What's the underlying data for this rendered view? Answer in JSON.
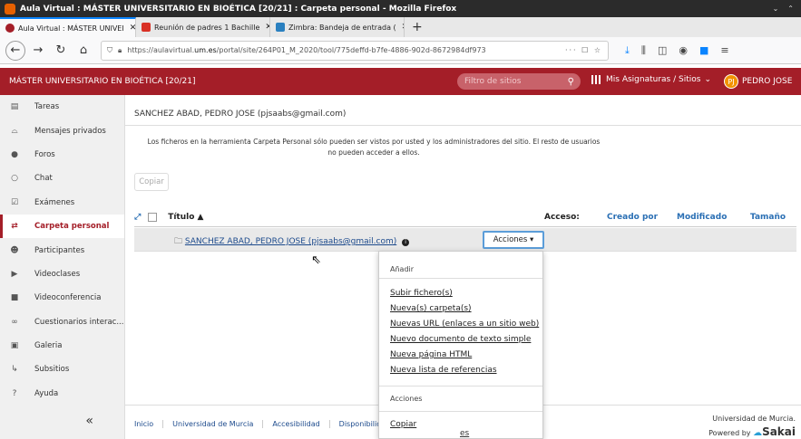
{
  "window": {
    "title": "Aula Virtual : MÁSTER UNIVERSITARIO EN BIOÉTICA [20/21] : Carpeta personal - Mozilla Firefox"
  },
  "tabs": [
    {
      "label": "Aula Virtual : MÁSTER UNIVEI",
      "active": true
    },
    {
      "label": "Reunión de padres 1 Bachille",
      "active": false
    },
    {
      "label": "Zimbra: Bandeja de entrada (",
      "active": false
    }
  ],
  "browser": {
    "url_prefix": "https://aulavirtual.",
    "url_domain": "um.es",
    "url_rest": "/portal/site/264P01_M_2020/tool/775deffd-b7fe-4886-902d-8672984df973",
    "url_actions": "··· ☐ ☆"
  },
  "site": {
    "title": "MÁSTER UNIVERSITARIO EN BIOÉTICA [20/21]",
    "filter_placeholder": "Filtro de sitios",
    "my_sites": "Mis Asignaturas / Sitios",
    "user_initials": "PJ",
    "user_name": "PEDRO JOSE"
  },
  "sidebar": {
    "items": [
      {
        "label": "Tareas",
        "icon": "file-icon"
      },
      {
        "label": "Mensajes privados",
        "icon": "inbox-icon"
      },
      {
        "label": "Foros",
        "icon": "comments-icon"
      },
      {
        "label": "Chat",
        "icon": "chat-icon"
      },
      {
        "label": "Exámenes",
        "icon": "check-icon"
      },
      {
        "label": "Carpeta personal",
        "icon": "swap-icon"
      },
      {
        "label": "Participantes",
        "icon": "users-icon"
      },
      {
        "label": "Videoclases",
        "icon": "youtube-icon"
      },
      {
        "label": "Videoconferencia",
        "icon": "video-camera-icon"
      },
      {
        "label": "Cuestionarios interac...",
        "icon": "quiz-icon"
      },
      {
        "label": "Galeria",
        "icon": "image-icon"
      },
      {
        "label": "Subsitios",
        "icon": "subsite-icon"
      },
      {
        "label": "Ayuda",
        "icon": "help-icon"
      }
    ],
    "collapse_glyph": "«"
  },
  "main": {
    "owner": "SANCHEZ ABAD, PEDRO JOSE (pjsaabs@gmail.com)",
    "notice": "Los ficheros en la herramienta Carpeta Personal sólo pueden ser vistos por usted y los administradores del sitio. El resto de usuarios no pueden acceder a ellos.",
    "copy_button": "Copiar",
    "columns": {
      "title": "Título ▲",
      "access": "Acceso:",
      "created_by": "Creado por",
      "modified": "Modificado",
      "size": "Tamaño"
    },
    "folder_name": "SANCHEZ ABAD, PEDRO JOSE (pjsaabs@gmail.com)",
    "actions_button": "Acciones ▾"
  },
  "dropdown": {
    "add_header": "Añadir",
    "add_items": [
      "Subir fichero(s)",
      "Nueva(s) carpeta(s)",
      "Nuevas URL (enlaces a un sitio web)",
      "Nuevo documento de texto simple",
      "Nueva página HTML",
      "Nueva lista de referencias"
    ],
    "actions_header": "Acciones",
    "copy_item": "Copiar",
    "trailing_text": "es"
  },
  "footer": {
    "links": [
      "Inicio",
      "Universidad de Murcia",
      "Accesibilidad",
      "Disponibilida"
    ],
    "university": "Universidad de Murcia.",
    "powered_by": "Powered by",
    "brand": "Sakai"
  }
}
